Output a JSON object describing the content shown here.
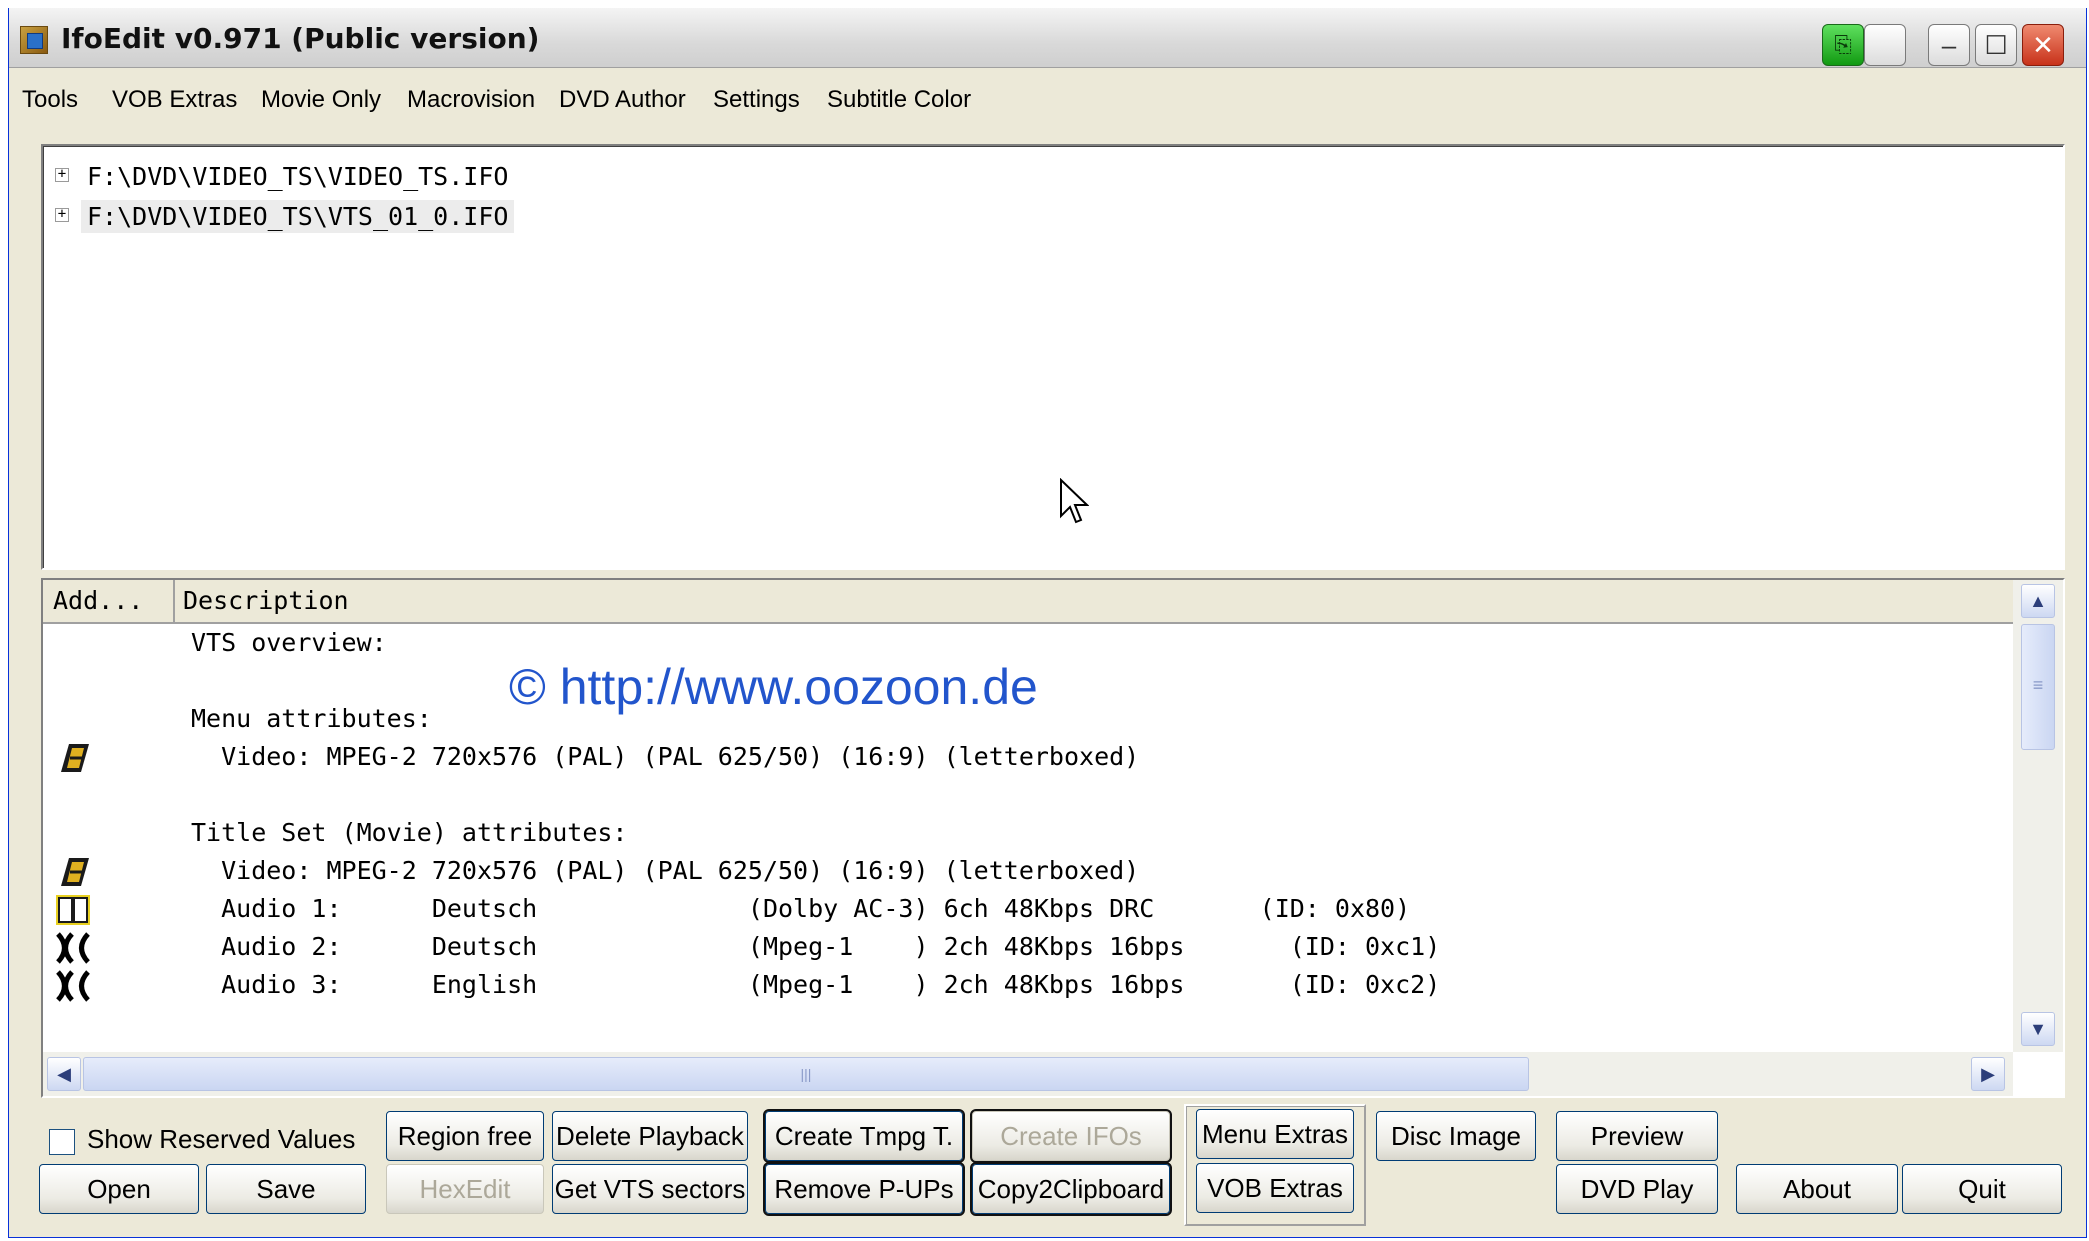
{
  "window": {
    "title": "IfoEdit v0.971 (Public version)"
  },
  "menu": [
    "Tools",
    "VOB Extras",
    "Movie Only",
    "Macrovision",
    "DVD Author",
    "Settings",
    "Subtitle Color"
  ],
  "tree": {
    "items": [
      {
        "label": "F:\\DVD\\VIDEO_TS\\VIDEO_TS.IFO",
        "expander": "+",
        "selected": false
      },
      {
        "label": "F:\\DVD\\VIDEO_TS\\VTS_01_0.IFO",
        "expander": "+",
        "selected": true
      }
    ]
  },
  "listview": {
    "columns": [
      "Add...",
      "Description"
    ],
    "rows": [
      {
        "icon": "",
        "text": "VTS overview:"
      },
      {
        "icon": "",
        "text": ""
      },
      {
        "icon": "",
        "text": "Menu attributes:"
      },
      {
        "icon": "video-icon",
        "text": "  Video: MPEG-2 720x576 (PAL) (PAL 625/50) (16:9) (letterboxed)"
      },
      {
        "icon": "",
        "text": ""
      },
      {
        "icon": "",
        "text": "Title Set (Movie) attributes:"
      },
      {
        "icon": "video-icon",
        "text": "  Video: MPEG-2 720x576 (PAL) (PAL 625/50) (16:9) (letterboxed)"
      },
      {
        "icon": "dolby-icon",
        "text": "  Audio 1:      Deutsch              (Dolby AC-3) 6ch 48Kbps DRC       (ID: 0x80)"
      },
      {
        "icon": "mpeg-audio-icon",
        "text": "  Audio 2:      Deutsch              (Mpeg-1    ) 2ch 48Kbps 16bps       (ID: 0xc1)"
      },
      {
        "icon": "mpeg-audio-icon",
        "text": "  Audio 3:      English              (Mpeg-1    ) 2ch 48Kbps 16bps       (ID: 0xc2)"
      }
    ],
    "watermark": "© http://www.oozoon.de"
  },
  "options": {
    "show_reserved_label": "Show Reserved Values",
    "show_reserved_checked": false
  },
  "buttons": {
    "region_free": "Region free",
    "delete_playback": "Delete Playback",
    "create_tmpg": "Create Tmpg T.",
    "create_ifos": "Create IFOs",
    "menu_extras": "Menu Extras",
    "disc_image": "Disc Image",
    "preview": "Preview",
    "open": "Open",
    "save": "Save",
    "hexedit": "HexEdit",
    "get_vts_sectors": "Get VTS sectors",
    "remove_pups": "Remove P-UPs",
    "copy2clipboard": "Copy2Clipboard",
    "vob_extras": "VOB Extras",
    "dvd_play": "DVD Play",
    "about": "About",
    "quit": "Quit"
  }
}
